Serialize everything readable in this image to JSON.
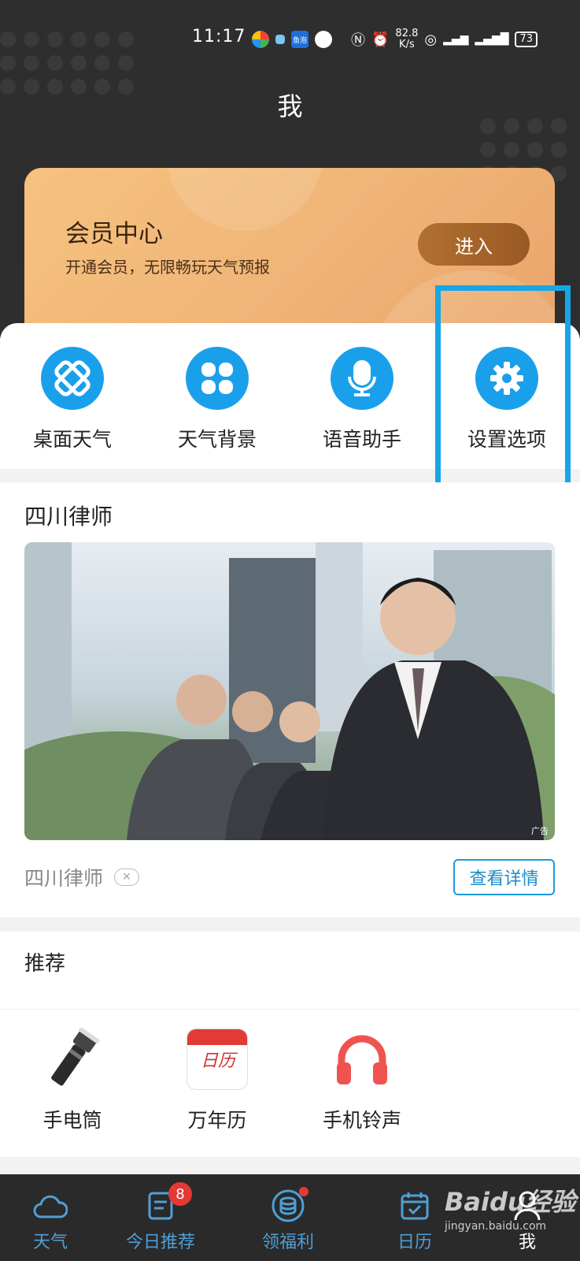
{
  "status_bar": {
    "time": "11:17",
    "net_speed_value": "82.8",
    "net_speed_unit": "K/s",
    "battery": "73",
    "app_badge": "鱼泡"
  },
  "header": {
    "title": "我"
  },
  "vip_card": {
    "title": "会员中心",
    "subtitle": "开通会员，无限畅玩天气预报",
    "enter_label": "进入"
  },
  "tools": [
    {
      "label": "桌面天气",
      "icon": "widget-icon"
    },
    {
      "label": "天气背景",
      "icon": "clover-icon"
    },
    {
      "label": "语音助手",
      "icon": "microphone-icon"
    },
    {
      "label": "设置选项",
      "icon": "gear-icon"
    }
  ],
  "ad": {
    "title": "四川律师",
    "source": "四川律师",
    "close_label": "✕",
    "detail_label": "查看详情",
    "tag": "广告"
  },
  "recommend": {
    "title": "推荐",
    "items": [
      {
        "label": "手电筒",
        "icon": "flashlight-icon"
      },
      {
        "label": "万年历",
        "icon": "calendar-icon",
        "icon_text": "日历"
      },
      {
        "label": "手机铃声",
        "icon": "headphones-icon"
      }
    ]
  },
  "bottom_nav": {
    "items": [
      {
        "label": "天气",
        "icon": "cloud-icon"
      },
      {
        "label": "今日推荐",
        "icon": "news-icon",
        "badge": "8"
      },
      {
        "label": "领福利",
        "icon": "coins-icon",
        "dot": true
      },
      {
        "label": "日历",
        "icon": "calendar-icon"
      },
      {
        "label": "我",
        "icon": "person-icon",
        "active": true
      }
    ]
  },
  "watermark": {
    "main": "Baidu经验",
    "url": "jingyan.baidu.com"
  },
  "colors": {
    "accent_blue": "#1aa0ea",
    "highlight_box": "#16a6e6",
    "vip_gold": "#f0b578",
    "badge_red": "#e53935",
    "nav_bg": "#2a2a2a"
  }
}
